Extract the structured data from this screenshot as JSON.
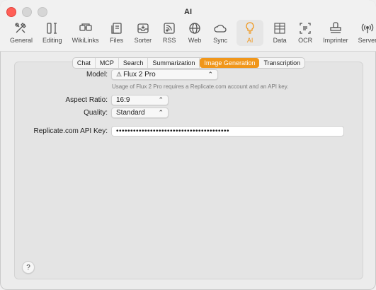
{
  "window": {
    "title": "AI"
  },
  "toolbar": {
    "items": [
      {
        "label": "General",
        "icon": "tools-icon"
      },
      {
        "label": "Editing",
        "icon": "text-cursor-icon"
      },
      {
        "label": "WikiLinks",
        "icon": "wikilinks-icon"
      },
      {
        "label": "Files",
        "icon": "files-icon"
      },
      {
        "label": "Sorter",
        "icon": "tray-icon"
      },
      {
        "label": "RSS",
        "icon": "rss-icon"
      },
      {
        "label": "Web",
        "icon": "globe-icon"
      },
      {
        "label": "Sync",
        "icon": "cloud-icon"
      },
      {
        "label": "AI",
        "icon": "lightbulb-icon",
        "active": true
      },
      {
        "label": "Data",
        "icon": "table-icon"
      },
      {
        "label": "OCR",
        "icon": "ocr-icon"
      },
      {
        "label": "Imprinter",
        "icon": "stamp-icon"
      },
      {
        "label": "Server",
        "icon": "broadcast-icon"
      }
    ],
    "accent_color": "#f0961a"
  },
  "tabs": {
    "items": [
      "Chat",
      "MCP",
      "Search",
      "Summarization",
      "Image Generation",
      "Transcription"
    ],
    "selected": "Image Generation"
  },
  "form": {
    "model_label": "Model:",
    "model_value": "Flux 2 Pro",
    "model_icon": "warning-triangle-icon",
    "model_hint": "Usage of Flux 2 Pro requires a Replicate.com account and an API key.",
    "aspect_label": "Aspect Ratio:",
    "aspect_value": "16:9",
    "quality_label": "Quality:",
    "quality_value": "Standard",
    "api_key_label": "Replicate.com API Key:",
    "api_key_value": "••••••••••••••••••••••••••••••••••••••••"
  },
  "help_label": "?"
}
